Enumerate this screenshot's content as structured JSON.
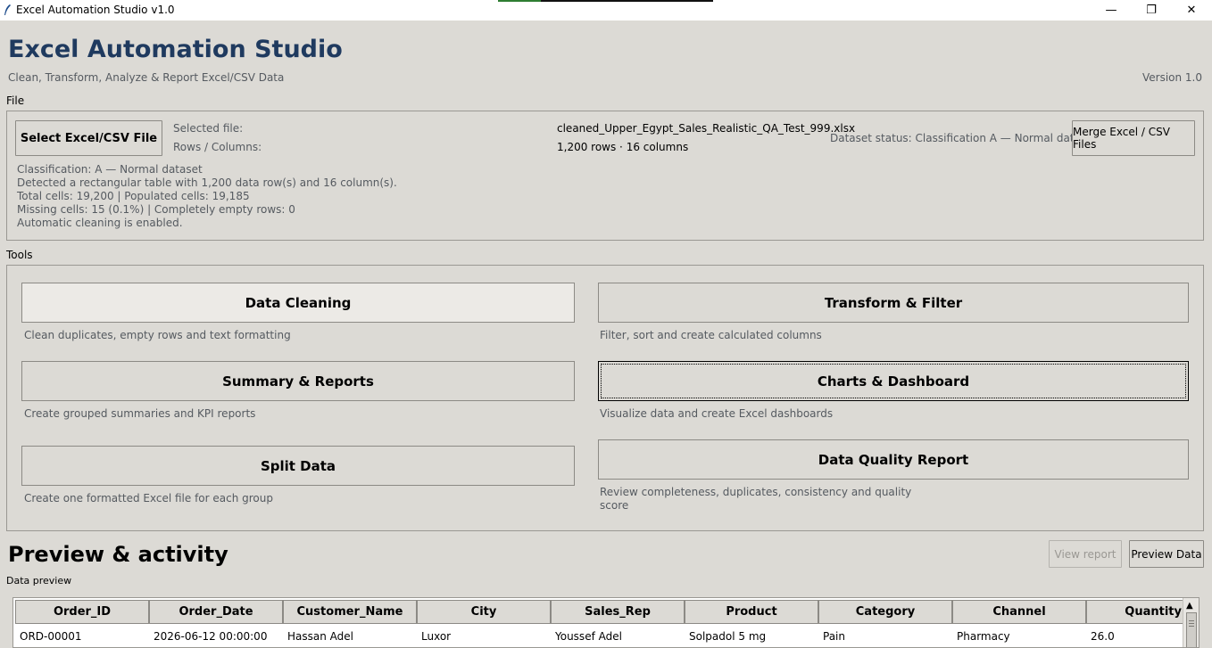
{
  "window": {
    "title": "Excel Automation Studio v1.0",
    "minimize_icon": "minimize-icon",
    "maximize_icon": "restore-icon",
    "close_icon": "close-icon",
    "minimize_glyph": "—",
    "maximize_glyph": "❐",
    "close_glyph": "✕"
  },
  "header": {
    "title": "Excel Automation Studio",
    "subtitle": "Clean, Transform, Analyze & Report Excel/CSV Data",
    "version": "Version 1.0"
  },
  "file_section": {
    "label": "File",
    "select_button": "Select Excel/CSV File",
    "selected_file_label": "Selected file:",
    "selected_file_value": "cleaned_Upper_Egypt_Sales_Realistic_QA_Test_999.xlsx",
    "rows_columns_label": "Rows / Columns:",
    "rows_columns_value": "1,200 rows · 16 columns",
    "dataset_status": "Dataset status: Classification A — Normal dataset",
    "merge_button": "Merge Excel / CSV Files",
    "classification_lines": [
      "Classification: A — Normal dataset",
      "Detected a rectangular table with 1,200 data row(s) and 16 column(s).",
      "Total cells: 19,200  |  Populated cells: 19,185",
      "Missing cells: 15 (0.1%)  |  Completely empty rows: 0",
      "Automatic cleaning is enabled."
    ]
  },
  "tools_section": {
    "label": "Tools",
    "tools": [
      {
        "label": "Data Cleaning",
        "description": "Clean duplicates, empty rows and text formatting"
      },
      {
        "label": "Transform & Filter",
        "description": "Filter, sort and create calculated columns"
      },
      {
        "label": "Summary & Reports",
        "description": "Create grouped summaries and KPI reports"
      },
      {
        "label": "Charts & Dashboard",
        "description": "Visualize data and create Excel dashboards"
      },
      {
        "label": "Split Data",
        "description": "Create one formatted Excel file for each group"
      },
      {
        "label": "Data Quality Report",
        "description_line1": "Review completeness, duplicates, consistency and quality",
        "description_line2": "score"
      }
    ]
  },
  "preview": {
    "title": "Preview & activity",
    "view_report_button": "View report",
    "preview_data_button": "Preview Data",
    "data_preview_label": "Data preview",
    "columns": [
      "Order_ID",
      "Order_Date",
      "Customer_Name",
      "City",
      "Sales_Rep",
      "Product",
      "Category",
      "Channel",
      "Quantity"
    ],
    "rows": [
      [
        "ORD-00001",
        "2026-06-12 00:00:00",
        "Hassan Adel",
        "Luxor",
        "Youssef Adel",
        "Solpadol 5 mg",
        "Pain",
        "Pharmacy",
        "26.0"
      ]
    ],
    "scroll_up_icon": "scroll-up-arrow-icon"
  }
}
